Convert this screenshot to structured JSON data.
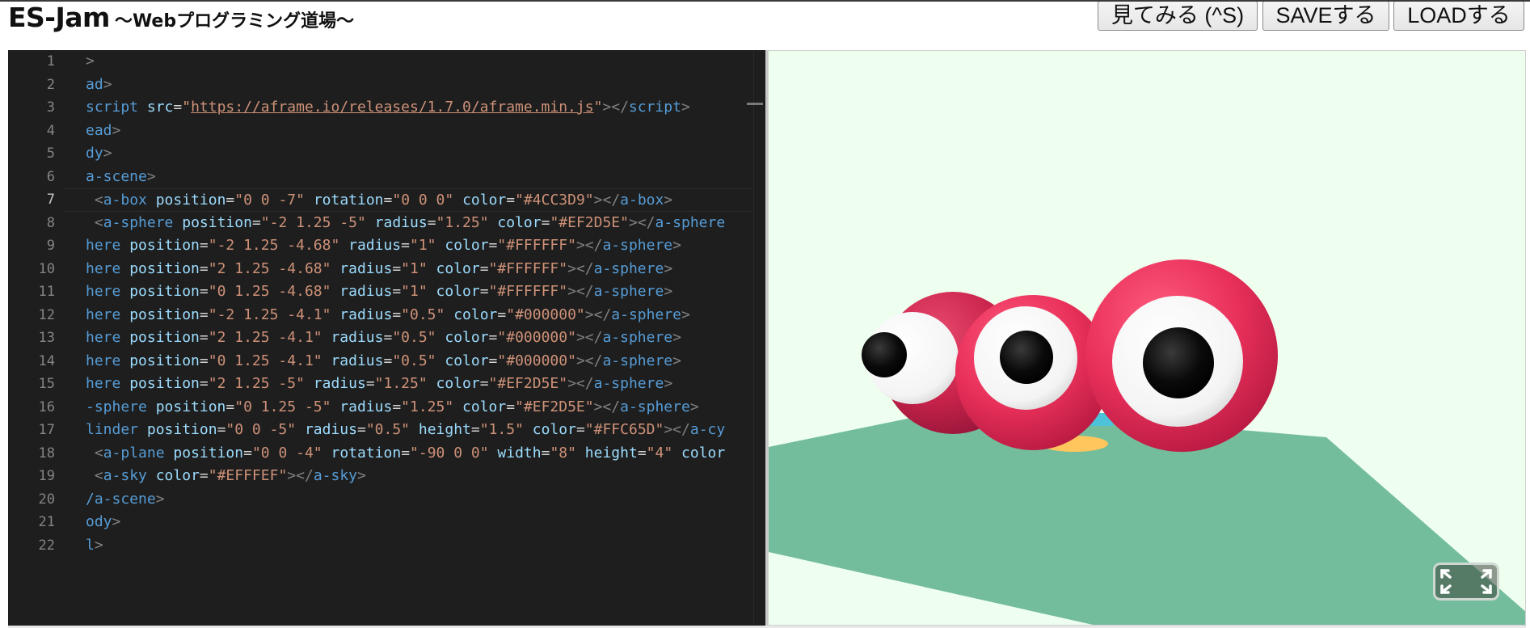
{
  "header": {
    "title": "ES-Jam",
    "subtitle": "～Webプログラミング道場～",
    "buttons": {
      "view": "見てみる (^S)",
      "save": "SAVEする",
      "load": "LOADする"
    }
  },
  "editor": {
    "active_line": 7,
    "lines": [
      {
        "n": "1",
        "tokens": [
          [
            "p",
            ">"
          ]
        ]
      },
      {
        "n": "2",
        "tokens": [
          [
            "t",
            "ad"
          ],
          [
            "p",
            ">"
          ]
        ]
      },
      {
        "n": "3",
        "tokens": [
          [
            "t",
            "script "
          ],
          [
            "a",
            "src"
          ],
          [
            "e",
            "="
          ],
          [
            "v",
            "\""
          ],
          [
            "u",
            "https://aframe.io/releases/1.7.0/aframe.min.js"
          ],
          [
            "v",
            "\""
          ],
          [
            "p",
            "></"
          ],
          [
            "t",
            "script"
          ],
          [
            "p",
            ">"
          ]
        ]
      },
      {
        "n": "4",
        "tokens": [
          [
            "t",
            "ead"
          ],
          [
            "p",
            ">"
          ]
        ]
      },
      {
        "n": "5",
        "tokens": [
          [
            "t",
            "dy"
          ],
          [
            "p",
            ">"
          ]
        ]
      },
      {
        "n": "6",
        "tokens": [
          [
            "t",
            "a-scene"
          ],
          [
            "p",
            ">"
          ]
        ]
      },
      {
        "n": "7",
        "tokens": [
          [
            "e",
            " "
          ],
          [
            "p",
            "<"
          ],
          [
            "t",
            "a-box "
          ],
          [
            "a",
            "position"
          ],
          [
            "e",
            "="
          ],
          [
            "v",
            "\"0 0 -7\" "
          ],
          [
            "a",
            "rotation"
          ],
          [
            "e",
            "="
          ],
          [
            "v",
            "\"0 0 0\" "
          ],
          [
            "a",
            "color"
          ],
          [
            "e",
            "="
          ],
          [
            "v",
            "\"#4CC3D9\""
          ],
          [
            "p",
            "></"
          ],
          [
            "t",
            "a-box"
          ],
          [
            "p",
            ">"
          ]
        ]
      },
      {
        "n": "8",
        "tokens": [
          [
            "e",
            " "
          ],
          [
            "p",
            "<"
          ],
          [
            "t",
            "a-sphere "
          ],
          [
            "a",
            "position"
          ],
          [
            "e",
            "="
          ],
          [
            "v",
            "\"-2 1.25 -5\" "
          ],
          [
            "a",
            "radius"
          ],
          [
            "e",
            "="
          ],
          [
            "v",
            "\"1.25\" "
          ],
          [
            "a",
            "color"
          ],
          [
            "e",
            "="
          ],
          [
            "v",
            "\"#EF2D5E\""
          ],
          [
            "p",
            "></"
          ],
          [
            "t",
            "a-sphere"
          ]
        ]
      },
      {
        "n": "9",
        "tokens": [
          [
            "t",
            "here "
          ],
          [
            "a",
            "position"
          ],
          [
            "e",
            "="
          ],
          [
            "v",
            "\"-2 1.25 -4.68\" "
          ],
          [
            "a",
            "radius"
          ],
          [
            "e",
            "="
          ],
          [
            "v",
            "\"1\" "
          ],
          [
            "a",
            "color"
          ],
          [
            "e",
            "="
          ],
          [
            "v",
            "\"#FFFFFF\""
          ],
          [
            "p",
            "></"
          ],
          [
            "t",
            "a-sphere"
          ],
          [
            "p",
            ">"
          ]
        ]
      },
      {
        "n": "10",
        "tokens": [
          [
            "t",
            "here "
          ],
          [
            "a",
            "position"
          ],
          [
            "e",
            "="
          ],
          [
            "v",
            "\"2 1.25 -4.68\" "
          ],
          [
            "a",
            "radius"
          ],
          [
            "e",
            "="
          ],
          [
            "v",
            "\"1\" "
          ],
          [
            "a",
            "color"
          ],
          [
            "e",
            "="
          ],
          [
            "v",
            "\"#FFFFFF\""
          ],
          [
            "p",
            "></"
          ],
          [
            "t",
            "a-sphere"
          ],
          [
            "p",
            ">"
          ]
        ]
      },
      {
        "n": "11",
        "tokens": [
          [
            "t",
            "here "
          ],
          [
            "a",
            "position"
          ],
          [
            "e",
            "="
          ],
          [
            "v",
            "\"0 1.25 -4.68\" "
          ],
          [
            "a",
            "radius"
          ],
          [
            "e",
            "="
          ],
          [
            "v",
            "\"1\" "
          ],
          [
            "a",
            "color"
          ],
          [
            "e",
            "="
          ],
          [
            "v",
            "\"#FFFFFF\""
          ],
          [
            "p",
            "></"
          ],
          [
            "t",
            "a-sphere"
          ],
          [
            "p",
            ">"
          ]
        ]
      },
      {
        "n": "12",
        "tokens": [
          [
            "t",
            "here "
          ],
          [
            "a",
            "position"
          ],
          [
            "e",
            "="
          ],
          [
            "v",
            "\"-2 1.25 -4.1\" "
          ],
          [
            "a",
            "radius"
          ],
          [
            "e",
            "="
          ],
          [
            "v",
            "\"0.5\" "
          ],
          [
            "a",
            "color"
          ],
          [
            "e",
            "="
          ],
          [
            "v",
            "\"#000000\""
          ],
          [
            "p",
            "></"
          ],
          [
            "t",
            "a-sphere"
          ],
          [
            "p",
            ">"
          ]
        ]
      },
      {
        "n": "13",
        "tokens": [
          [
            "t",
            "here "
          ],
          [
            "a",
            "position"
          ],
          [
            "e",
            "="
          ],
          [
            "v",
            "\"2 1.25 -4.1\" "
          ],
          [
            "a",
            "radius"
          ],
          [
            "e",
            "="
          ],
          [
            "v",
            "\"0.5\" "
          ],
          [
            "a",
            "color"
          ],
          [
            "e",
            "="
          ],
          [
            "v",
            "\"#000000\""
          ],
          [
            "p",
            "></"
          ],
          [
            "t",
            "a-sphere"
          ],
          [
            "p",
            ">"
          ]
        ]
      },
      {
        "n": "14",
        "tokens": [
          [
            "t",
            "here "
          ],
          [
            "a",
            "position"
          ],
          [
            "e",
            "="
          ],
          [
            "v",
            "\"0 1.25 -4.1\" "
          ],
          [
            "a",
            "radius"
          ],
          [
            "e",
            "="
          ],
          [
            "v",
            "\"0.5\" "
          ],
          [
            "a",
            "color"
          ],
          [
            "e",
            "="
          ],
          [
            "v",
            "\"#000000\""
          ],
          [
            "p",
            "></"
          ],
          [
            "t",
            "a-sphere"
          ],
          [
            "p",
            ">"
          ]
        ]
      },
      {
        "n": "15",
        "tokens": [
          [
            "t",
            "here "
          ],
          [
            "a",
            "position"
          ],
          [
            "e",
            "="
          ],
          [
            "v",
            "\"2 1.25 -5\" "
          ],
          [
            "a",
            "radius"
          ],
          [
            "e",
            "="
          ],
          [
            "v",
            "\"1.25\" "
          ],
          [
            "a",
            "color"
          ],
          [
            "e",
            "="
          ],
          [
            "v",
            "\"#EF2D5E\""
          ],
          [
            "p",
            "></"
          ],
          [
            "t",
            "a-sphere"
          ],
          [
            "p",
            ">"
          ]
        ]
      },
      {
        "n": "16",
        "tokens": [
          [
            "t",
            "-sphere "
          ],
          [
            "a",
            "position"
          ],
          [
            "e",
            "="
          ],
          [
            "v",
            "\"0 1.25 -5\" "
          ],
          [
            "a",
            "radius"
          ],
          [
            "e",
            "="
          ],
          [
            "v",
            "\"1.25\" "
          ],
          [
            "a",
            "color"
          ],
          [
            "e",
            "="
          ],
          [
            "v",
            "\"#EF2D5E\""
          ],
          [
            "p",
            "></"
          ],
          [
            "t",
            "a-sphere"
          ],
          [
            "p",
            ">"
          ]
        ]
      },
      {
        "n": "17",
        "tokens": [
          [
            "t",
            "linder "
          ],
          [
            "a",
            "position"
          ],
          [
            "e",
            "="
          ],
          [
            "v",
            "\"0 0 -5\" "
          ],
          [
            "a",
            "radius"
          ],
          [
            "e",
            "="
          ],
          [
            "v",
            "\"0.5\" "
          ],
          [
            "a",
            "height"
          ],
          [
            "e",
            "="
          ],
          [
            "v",
            "\"1.5\" "
          ],
          [
            "a",
            "color"
          ],
          [
            "e",
            "="
          ],
          [
            "v",
            "\"#FFC65D\""
          ],
          [
            "p",
            "></"
          ],
          [
            "t",
            "a-cy"
          ]
        ]
      },
      {
        "n": "18",
        "tokens": [
          [
            "e",
            " "
          ],
          [
            "p",
            "<"
          ],
          [
            "t",
            "a-plane "
          ],
          [
            "a",
            "position"
          ],
          [
            "e",
            "="
          ],
          [
            "v",
            "\"0 0 -4\" "
          ],
          [
            "a",
            "rotation"
          ],
          [
            "e",
            "="
          ],
          [
            "v",
            "\"-90 0 0\" "
          ],
          [
            "a",
            "width"
          ],
          [
            "e",
            "="
          ],
          [
            "v",
            "\"8\" "
          ],
          [
            "a",
            "height"
          ],
          [
            "e",
            "="
          ],
          [
            "v",
            "\"4\" "
          ],
          [
            "a",
            "color"
          ]
        ]
      },
      {
        "n": "19",
        "tokens": [
          [
            "e",
            " "
          ],
          [
            "p",
            "<"
          ],
          [
            "t",
            "a-sky "
          ],
          [
            "a",
            "color"
          ],
          [
            "e",
            "="
          ],
          [
            "v",
            "\"#EFFFEF\""
          ],
          [
            "p",
            "></"
          ],
          [
            "t",
            "a-sky"
          ],
          [
            "p",
            ">"
          ]
        ]
      },
      {
        "n": "20",
        "tokens": [
          [
            "t",
            "/a-scene"
          ],
          [
            "p",
            ">"
          ]
        ]
      },
      {
        "n": "21",
        "tokens": [
          [
            "t",
            "ody"
          ],
          [
            "p",
            ">"
          ]
        ]
      },
      {
        "n": "22",
        "tokens": [
          [
            "t",
            "l"
          ],
          [
            "p",
            ">"
          ]
        ]
      }
    ]
  },
  "scene": {
    "sky_color": "#EFFFEF",
    "plane_color": "#74BD9C",
    "sphere_color": "#EF2D5E",
    "eye_white_color": "#FFFFFF",
    "pupil_color": "#000000",
    "cylinder_color": "#FFC65D",
    "box_color": "#4CC3D9",
    "fullscreen_icon": "fullscreen-icon"
  },
  "colors": {
    "editor_bg": "#1E1E1E",
    "tag": "#569CD6",
    "attribute": "#9CDCFE",
    "string": "#CE9178",
    "punctuation": "#808080"
  }
}
